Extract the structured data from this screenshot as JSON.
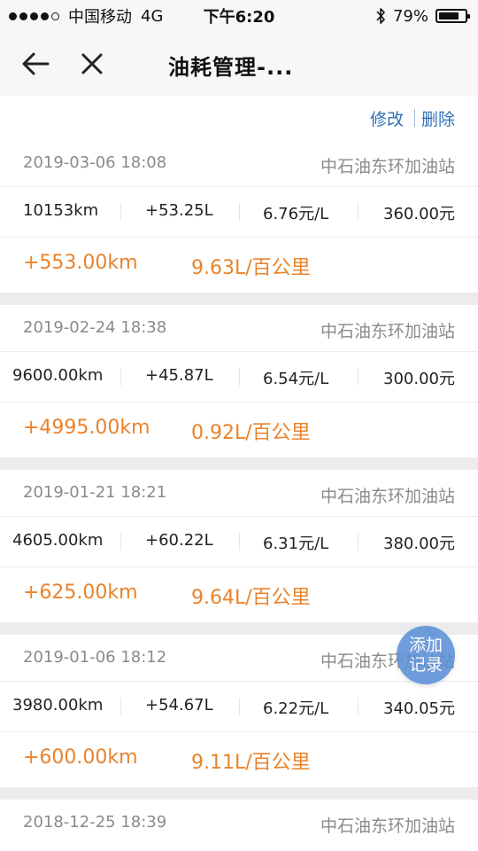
{
  "status_bar": {
    "carrier": "中国移动",
    "network": "4G",
    "time": "下午6:20",
    "battery_text": "79%",
    "battery_level": 0.79,
    "signal_bars_filled": 4,
    "signal_bars_total": 5,
    "icons": [
      "bluetooth-icon",
      "battery-icon"
    ]
  },
  "header": {
    "title": "油耗管理-...",
    "back_icon": "arrow-left",
    "close_icon": "close-x"
  },
  "actions": {
    "edit_label": "修改",
    "delete_label": "删除"
  },
  "records": [
    {
      "datetime": "2019-03-06 18:08",
      "station": "中石油东环加油站",
      "odometer": "10153km",
      "fuel": "+53.25L",
      "price": "6.76元/L",
      "cost": "360.00元",
      "distance": "+553.00km",
      "consumption": "9.63L/百公里"
    },
    {
      "datetime": "2019-02-24 18:38",
      "station": "中石油东环加油站",
      "odometer": "9600.00km",
      "fuel": "+45.87L",
      "price": "6.54元/L",
      "cost": "300.00元",
      "distance": "+4995.00km",
      "consumption": "0.92L/百公里"
    },
    {
      "datetime": "2019-01-21 18:21",
      "station": "中石油东环加油站",
      "odometer": "4605.00km",
      "fuel": "+60.22L",
      "price": "6.31元/L",
      "cost": "380.00元",
      "distance": "+625.00km",
      "consumption": "9.64L/百公里"
    },
    {
      "datetime": "2019-01-06 18:12",
      "station": "中石油东环加油站",
      "odometer": "3980.00km",
      "fuel": "+54.67L",
      "price": "6.22元/L",
      "cost": "340.05元",
      "distance": "+600.00km",
      "consumption": "9.11L/百公里"
    },
    {
      "datetime": "2018-12-25 18:39",
      "station": "中石油东环加油站"
    }
  ],
  "fab": {
    "line1": "添加",
    "line2": "记录"
  },
  "colors": {
    "accent_blue": "#2e6fb6",
    "highlight_orange": "#e9832b",
    "fab_blue": "#5c8fd6",
    "muted_gray": "#8a8a8a"
  }
}
